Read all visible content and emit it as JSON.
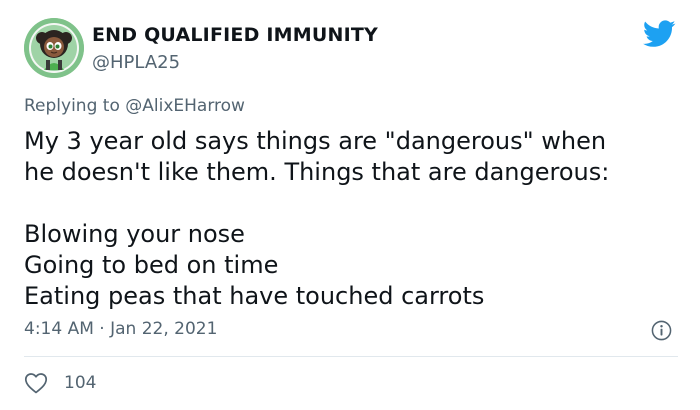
{
  "author": {
    "display_name": "END QUALIFIED IMMUNITY",
    "handle": "@HPLA25",
    "avatar_icon": "cartoon-girl-avatar"
  },
  "brand": {
    "icon": "twitter-bird-icon",
    "color": "#1da1f2"
  },
  "reply_context": {
    "prefix": "Replying to ",
    "mention": "@AlixEHarrow"
  },
  "tweet": {
    "lines": [
      "My 3 year old says things are \"dangerous\" when",
      "he doesn't like them. Things that are dangerous:"
    ],
    "list": [
      "Blowing your nose",
      "Going to bed on time",
      "Eating peas that have touched carrots"
    ]
  },
  "meta": {
    "timestamp": "4:14 AM · Jan 22, 2021",
    "info_icon": "info-icon"
  },
  "engagement": {
    "like_icon": "heart-icon",
    "likes": "104"
  },
  "colors": {
    "text": "#0f1419",
    "secondary": "#536471",
    "divider": "#e1e8ed",
    "avatar_ring": "#8bc98f"
  }
}
